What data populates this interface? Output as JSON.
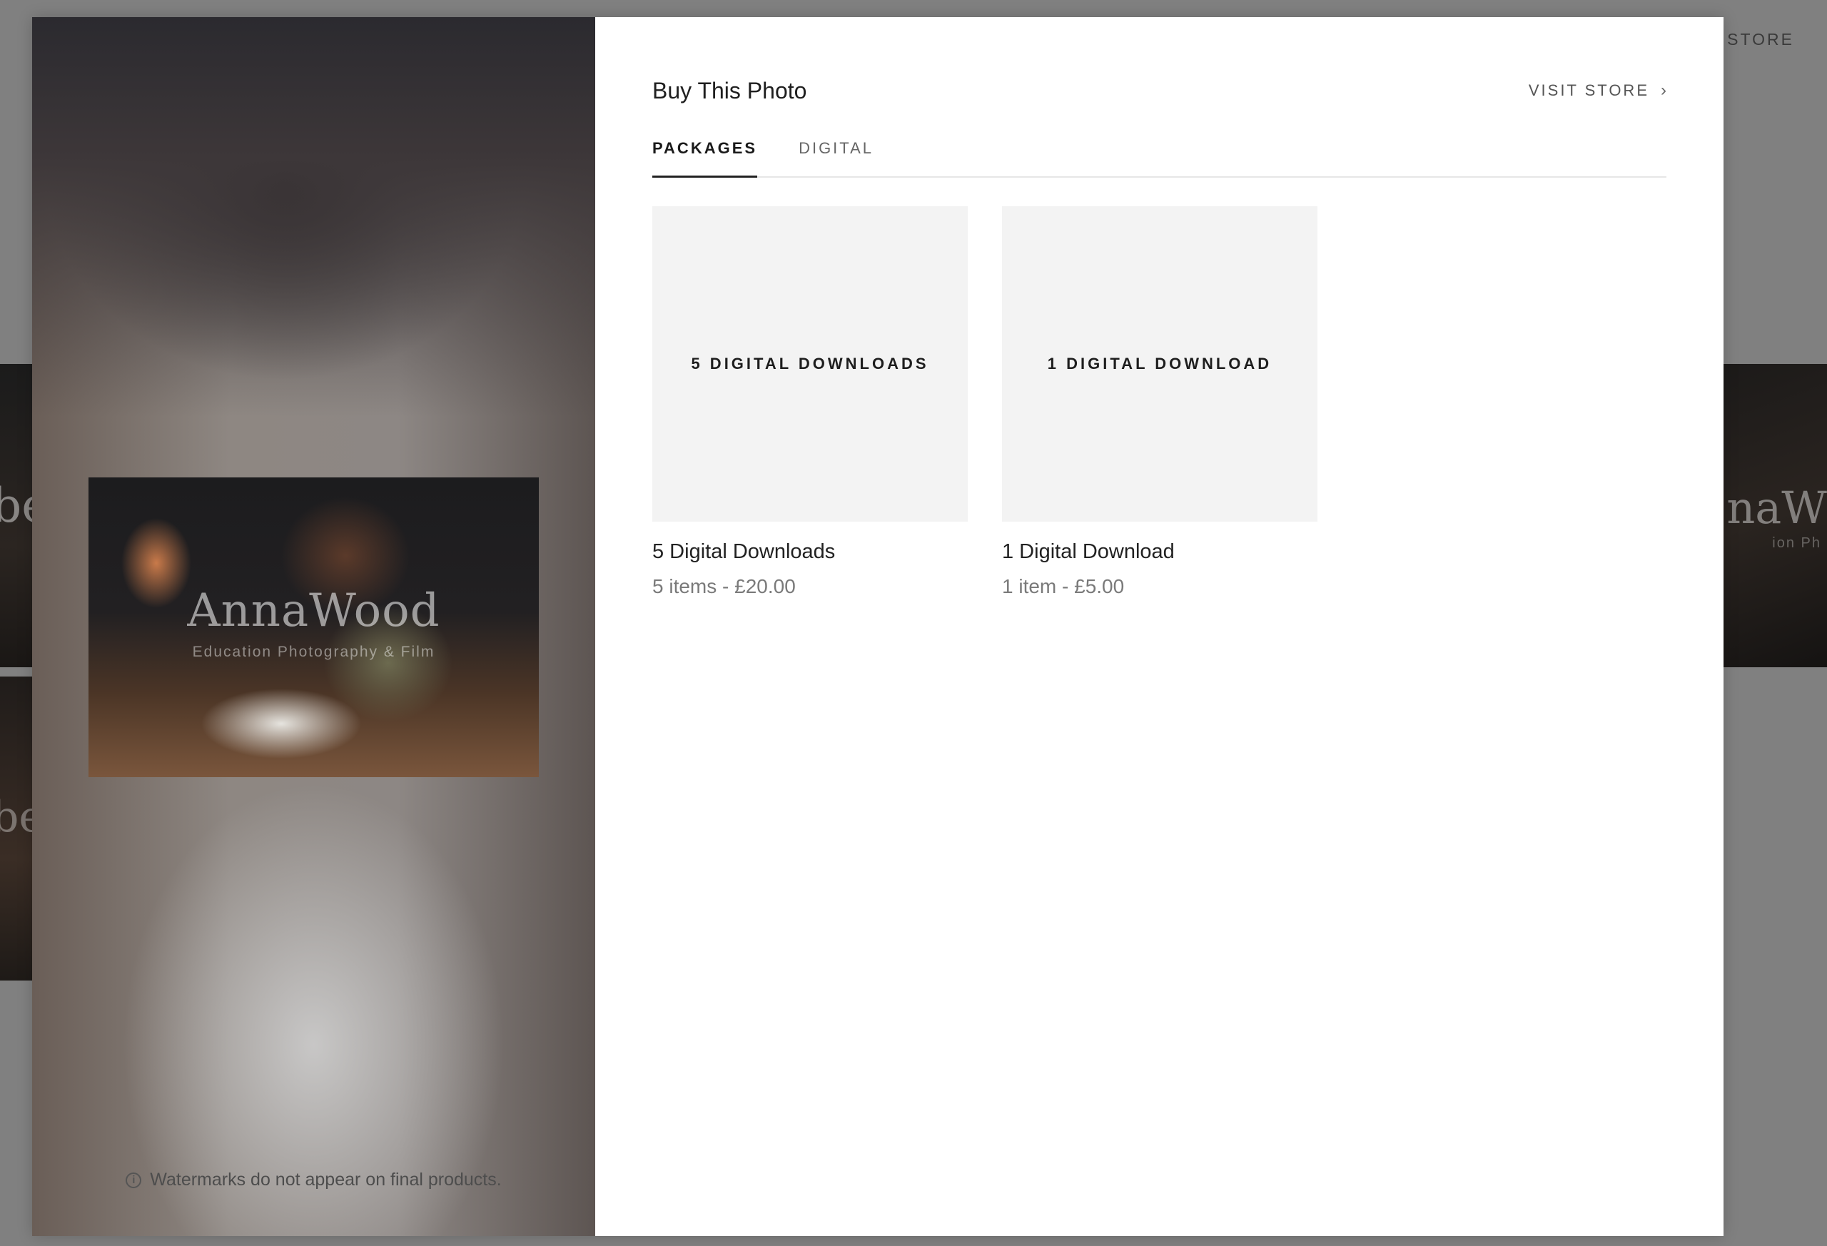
{
  "background": {
    "store_label": "T STORE",
    "watermark_left": "be",
    "watermark_left2": "be",
    "watermark_right": "naW",
    "watermark_right_sub": "ion Ph"
  },
  "preview": {
    "photo_watermark": "AnnaWood",
    "photo_watermark_sub": "Education Photography & Film",
    "note": "Watermarks do not appear on final products."
  },
  "dialog": {
    "title": "Buy This Photo",
    "visit_store_label": "VISIT STORE",
    "tabs": [
      {
        "label": "PACKAGES",
        "active": true
      },
      {
        "label": "DIGITAL",
        "active": false
      }
    ],
    "packages": [
      {
        "thumb_label": "5 DIGITAL DOWNLOADS",
        "name": "5 Digital Downloads",
        "price": "5 items - £20.00"
      },
      {
        "thumb_label": "1 DIGITAL DOWNLOAD",
        "name": "1 Digital Download",
        "price": "1 item - £5.00"
      }
    ]
  }
}
